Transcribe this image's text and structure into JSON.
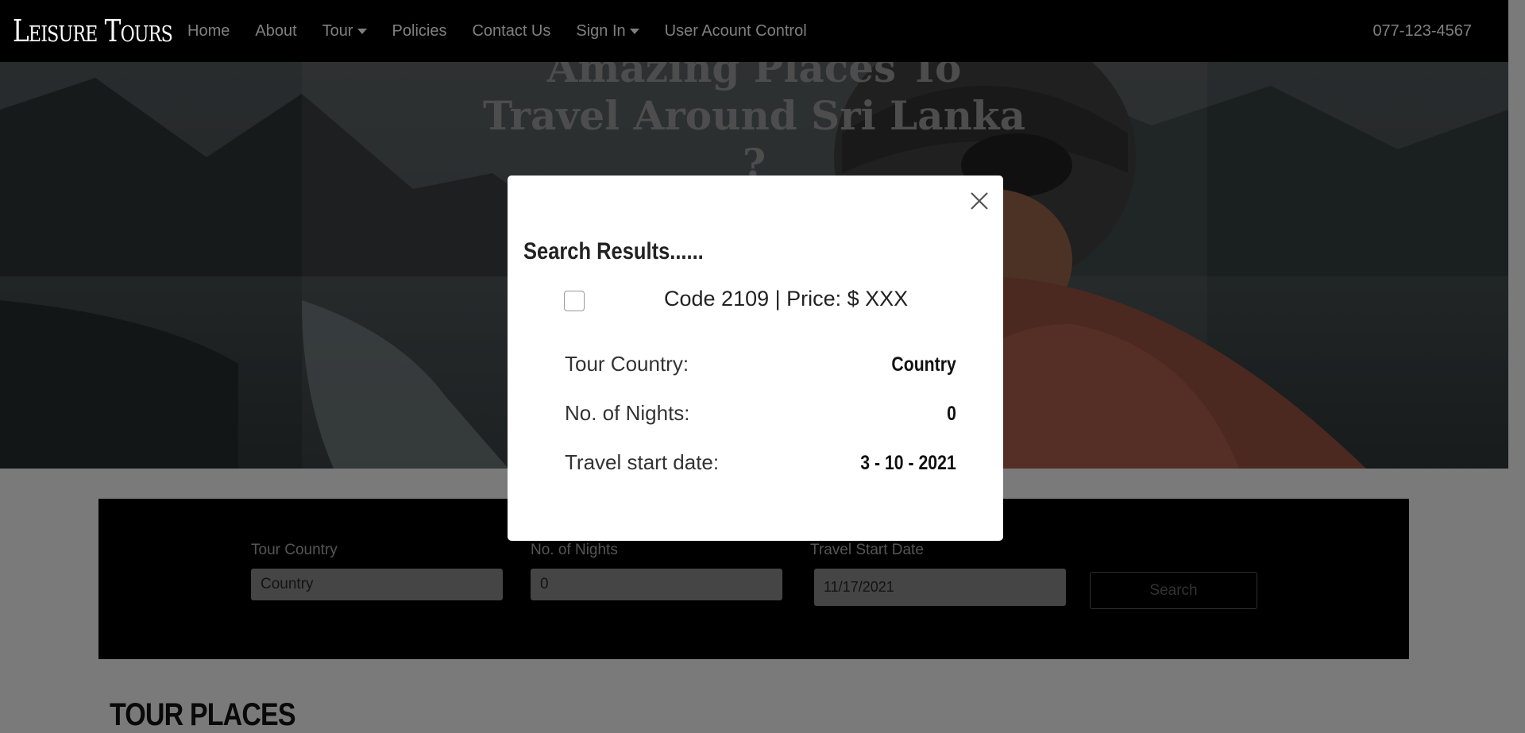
{
  "navbar": {
    "brand": "Leisure Tours",
    "items": [
      {
        "label": "Home",
        "dropdown": false
      },
      {
        "label": "About",
        "dropdown": false
      },
      {
        "label": "Tour",
        "dropdown": true
      },
      {
        "label": "Policies",
        "dropdown": false
      },
      {
        "label": "Contact Us",
        "dropdown": false
      },
      {
        "label": "Sign In",
        "dropdown": true
      },
      {
        "label": "User Acount Control",
        "dropdown": false
      }
    ],
    "phone": "077-123-4567"
  },
  "hero": {
    "title_line1": "Amazing Places To",
    "title_line2": "Travel Around Sri Lanka",
    "title_line3": "?"
  },
  "search": {
    "country_label": "Tour Country",
    "country_value": "Country",
    "nights_label": "No. of Nights",
    "nights_value": "0",
    "date_label": "Travel Start Date",
    "date_value": "11/17/2021",
    "button_label": "Search"
  },
  "section": {
    "title": "TOUR PLACES"
  },
  "modal": {
    "title": "Search Results......",
    "result_code": "Code 2109 | Price: $ XXX",
    "country_label": "Tour Country:",
    "country_value": "Country",
    "nights_label": "No. of Nights:",
    "nights_value": "0",
    "date_label": "Travel start date:",
    "date_value": "3 - 10 - 2021"
  }
}
